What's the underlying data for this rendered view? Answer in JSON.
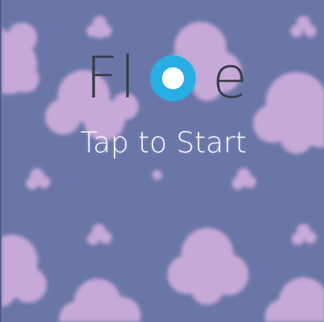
{
  "title": {
    "left": "Fl",
    "right": "e"
  },
  "prompt": "Tap to Start",
  "colors": {
    "background": "#6b76a8",
    "cloud": "#c7a9d8",
    "title_text": "#3a3f4f",
    "logo_ring": "#29aee3",
    "logo_core": "#ffffff",
    "prompt_text": "#f4f1f7"
  },
  "logo_icon": "blue-ring-icon"
}
